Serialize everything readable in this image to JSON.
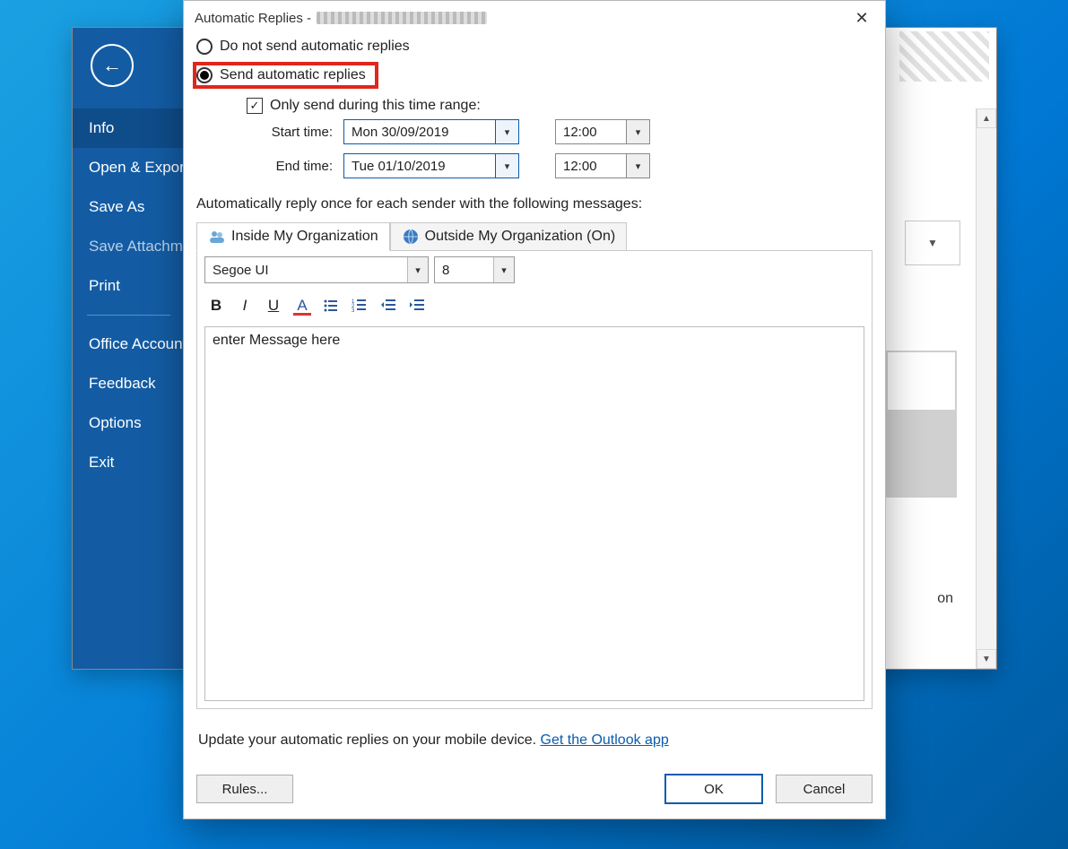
{
  "sidebar": {
    "items": [
      {
        "label": "Info",
        "selected": true
      },
      {
        "label": "Open & Export"
      },
      {
        "label": "Save As"
      },
      {
        "label": "Save Attachments",
        "faded": true
      },
      {
        "label": "Print"
      },
      {
        "sep": true
      },
      {
        "label": "Office Account"
      },
      {
        "label": "Feedback"
      },
      {
        "label": "Options"
      },
      {
        "label": "Exit"
      }
    ]
  },
  "bg": {
    "text_on": "on"
  },
  "dialog": {
    "title_prefix": "Automatic Replies - ",
    "radio_do_not_send": "Do not send automatic replies",
    "radio_send": "Send automatic replies",
    "selected_radio": "send",
    "only_send_label": "Only send during this time range:",
    "only_send_checked": true,
    "start_label": "Start time:",
    "end_label": "End time:",
    "start_date": "Mon 30/09/2019",
    "start_time": "12:00",
    "end_date": "Tue 01/10/2019",
    "end_time": "12:00",
    "auto_reply_note": "Automatically reply once for each sender with the following messages:",
    "tabs": {
      "inside": "Inside My Organization",
      "outside": "Outside My Organization (On)"
    },
    "editor": {
      "font_name": "Segoe UI",
      "font_size": "8",
      "body_text": "enter Message here"
    },
    "mobile_note_text": "Update your automatic replies on your mobile device. ",
    "mobile_note_link": "Get the Outlook app",
    "buttons": {
      "rules": "Rules...",
      "ok": "OK",
      "cancel": "Cancel"
    }
  }
}
